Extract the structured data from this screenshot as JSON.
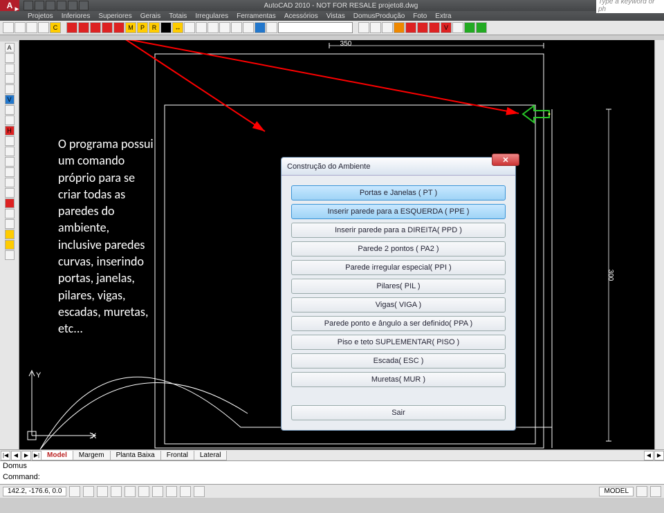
{
  "app": {
    "title_center": "AutoCAD 2010 - NOT FOR RESALE    projeto8.dwg",
    "search_placeholder": "Type a keyword or ph",
    "logo_text": "A"
  },
  "menu": [
    "Projetos",
    "Inferiores",
    "Superiores",
    "Gerais",
    "Totais",
    "Irregulares",
    "Ferramentas",
    "Acessórios",
    "Vistas",
    "DomusProdução",
    "Foto",
    "Extra"
  ],
  "canvas": {
    "dim_top": "350",
    "dim_right": "300"
  },
  "annotation": "O programa possui um comando próprio para se criar todas as paredes do ambiente, inclusive paredes curvas, inserindo portas, janelas, pilares, vigas, escadas, muretas, etc...",
  "dialog": {
    "title": "Construção do Ambiente",
    "buttons": [
      "Portas e Janelas ( PT )",
      "Inserir parede para a ESQUERDA ( PPE )",
      "Inserir parede para a DIREITA( PPD )",
      "Parede 2 pontos ( PA2 )",
      "Parede irregular especial( PPI )",
      "Pilares( PIL )",
      "Vigas( VIGA )",
      "Parede ponto e ângulo a ser definido( PPA )",
      "Piso e teto SUPLEMENTAR( PISO )",
      "Escada( ESC )",
      "Muretas( MUR )"
    ],
    "exit_label": "Sair",
    "close_glyph": "✕"
  },
  "sheettabs": {
    "nav": [
      "|◀",
      "◀",
      "▶",
      "▶|"
    ],
    "tabs": [
      "Model",
      "Margem",
      "Planta Baixa",
      "Frontal",
      "Lateral"
    ],
    "active": "Model"
  },
  "cmd": {
    "line1": "Domus",
    "line2": "Command:"
  },
  "status": {
    "coords": "142.2, -176.6, 0.0",
    "model_label": "MODEL"
  },
  "axes": {
    "x": "X",
    "y": "Y"
  }
}
